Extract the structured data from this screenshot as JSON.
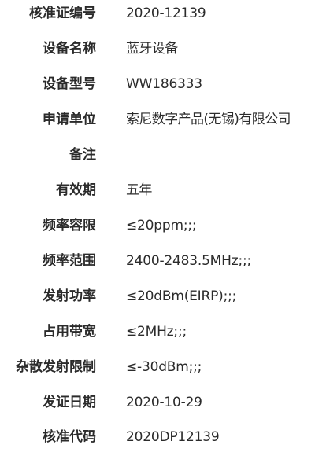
{
  "fields": [
    {
      "label": "核准证编号",
      "value": "2020-12139"
    },
    {
      "label": "设备名称",
      "value": "蓝牙设备"
    },
    {
      "label": "设备型号",
      "value": "WW186333"
    },
    {
      "label": "申请单位",
      "value": "索尼数字产品(无锡)有限公司"
    },
    {
      "label": "备注",
      "value": ""
    },
    {
      "label": "有效期",
      "value": "五年"
    },
    {
      "label": "频率容限",
      "value": "≤20ppm;;;"
    },
    {
      "label": "频率范围",
      "value": "2400-2483.5MHz;;;"
    },
    {
      "label": "发射功率",
      "value": "≤20dBm(EIRP);;;"
    },
    {
      "label": "占用带宽",
      "value": "≤2MHz;;;"
    },
    {
      "label": "杂散发射限制",
      "value": "≤-30dBm;;;"
    },
    {
      "label": "发证日期",
      "value": "2020-10-29"
    },
    {
      "label": "核准代码",
      "value": "2020DP12139"
    }
  ]
}
